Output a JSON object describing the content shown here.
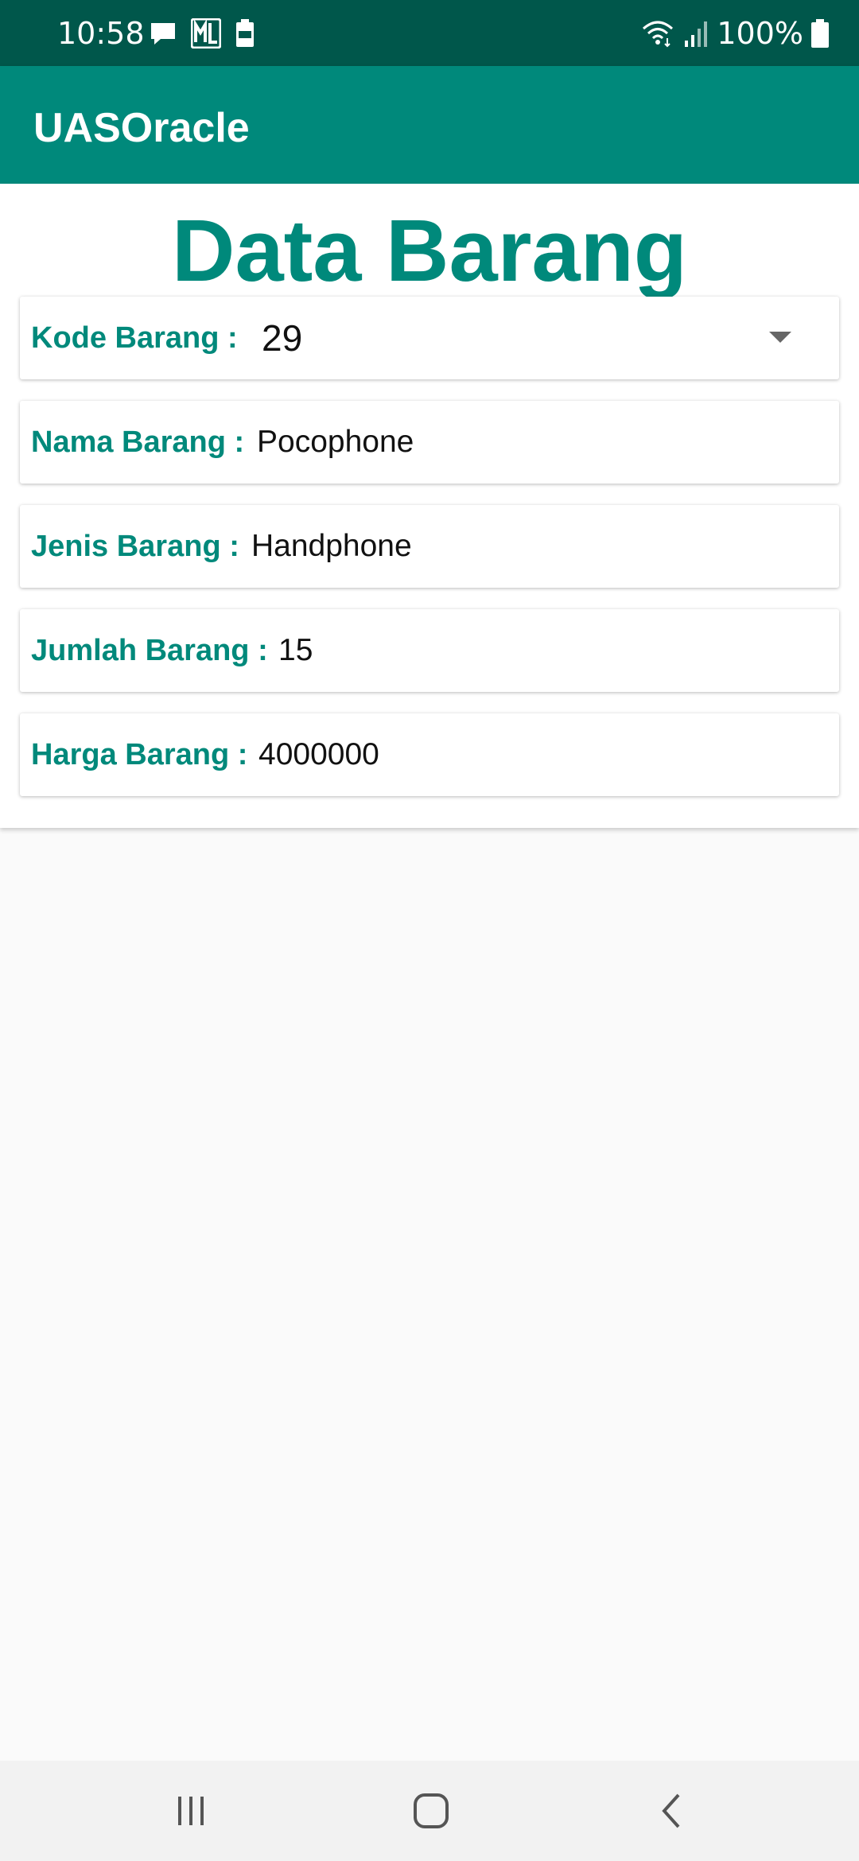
{
  "status_bar": {
    "time": "10:58",
    "battery_percent": "100%",
    "left_icons": [
      "message-icon",
      "ml-app-icon",
      "battery-saver-100-icon"
    ],
    "right_icons": [
      "wifi-icon",
      "signal-icon",
      "battery-icon"
    ]
  },
  "app_bar": {
    "title": "UASOracle"
  },
  "page": {
    "heading": "Data Barang"
  },
  "fields": {
    "kode": {
      "label": "Kode Barang :",
      "value": "29"
    },
    "nama": {
      "label": "Nama Barang :",
      "value": "Pocophone"
    },
    "jenis": {
      "label": "Jenis Barang :",
      "value": "Handphone"
    },
    "jumlah": {
      "label": "Jumlah Barang :",
      "value": "15"
    },
    "harga": {
      "label": "Harga Barang :",
      "value": "4000000"
    }
  },
  "nav_bar": {
    "buttons": [
      "recent-apps-icon",
      "home-icon",
      "back-icon"
    ]
  },
  "colors": {
    "primary": "#00897b",
    "primary_dark": "#00574b",
    "background": "#fafafa"
  }
}
